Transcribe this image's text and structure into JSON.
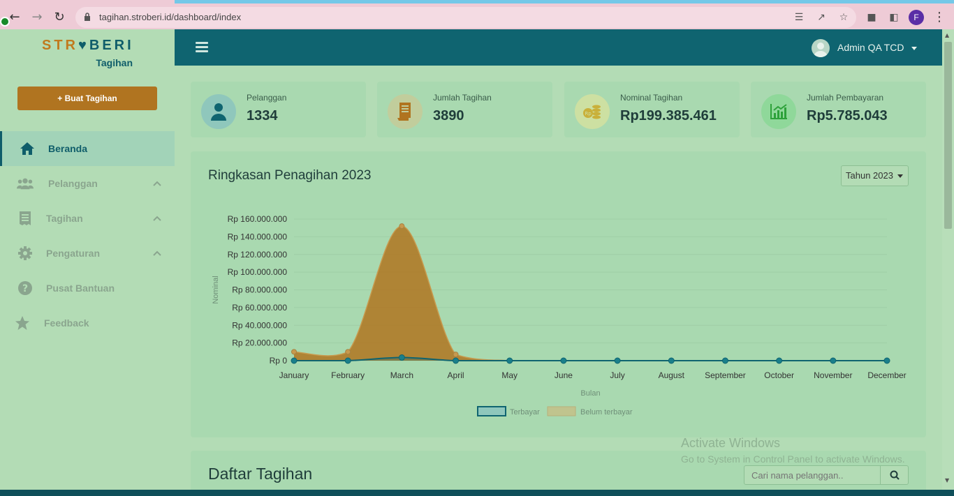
{
  "browser": {
    "url": "tagihan.stroberi.id/dashboard/index",
    "profile_initial": "F"
  },
  "sidebar": {
    "logo_word_left": "STR",
    "logo_word_right": "BERI",
    "logo_sub": "Tagihan",
    "create_button": "+ Buat Tagihan",
    "items": [
      {
        "label": "Beranda",
        "icon": "home-icon",
        "active": true
      },
      {
        "label": "Pelanggan",
        "icon": "users-icon",
        "expandable": true
      },
      {
        "label": "Tagihan",
        "icon": "receipt-icon",
        "expandable": true
      },
      {
        "label": "Pengaturan",
        "icon": "gear-icon",
        "expandable": true
      },
      {
        "label": "Pusat Bantuan",
        "icon": "question-icon"
      },
      {
        "label": "Feedback",
        "icon": "star-icon"
      }
    ]
  },
  "topbar": {
    "user_name": "Admin QA TCD"
  },
  "cards": [
    {
      "label": "Pelanggan",
      "value": "1334",
      "icon": "user-icon",
      "color": "#0f6470"
    },
    {
      "label": "Jumlah Tagihan",
      "value": "3890",
      "icon": "invoice-icon",
      "color": "#b07420"
    },
    {
      "label": "Nominal Tagihan",
      "value": "Rp199.385.461",
      "icon": "coins-icon",
      "color": "#c9b03a"
    },
    {
      "label": "Jumlah Pembayaran",
      "value": "Rp5.785.043",
      "icon": "chart-up-icon",
      "color": "#2da13a"
    }
  ],
  "summary": {
    "title": "Ringkasan Penagihan 2023",
    "year_select": "Tahun 2023"
  },
  "chart_data": {
    "type": "area",
    "categories": [
      "January",
      "February",
      "March",
      "April",
      "May",
      "June",
      "July",
      "August",
      "September",
      "October",
      "November",
      "December"
    ],
    "series": [
      {
        "name": "Terbayar",
        "values": [
          0,
          0,
          3500000,
          0,
          0,
          0,
          0,
          0,
          0,
          0,
          0,
          0
        ],
        "color": "#0f6470"
      },
      {
        "name": "Belum terbayar",
        "values": [
          10000000,
          10000000,
          152000000,
          7000000,
          0,
          0,
          0,
          0,
          0,
          0,
          0,
          0
        ],
        "color": "#b07420"
      }
    ],
    "y_ticks": [
      "Rp 0",
      "Rp 20.000.000",
      "Rp 40.000.000",
      "Rp 60.000.000",
      "Rp 80.000.000",
      "Rp 100.000.000",
      "Rp 120.000.000",
      "Rp 140.000.000",
      "Rp 160.000.000"
    ],
    "ylim": [
      0,
      160000000
    ],
    "xlabel": "Bulan",
    "ylabel": "Nominal",
    "legend": "bottom",
    "grid": true
  },
  "invoices": {
    "title": "Daftar Tagihan",
    "search_placeholder": "Cari nama pelanggan.."
  },
  "watermark": {
    "line1": "Activate Windows",
    "line2": "Go to System in Control Panel to activate Windows."
  }
}
